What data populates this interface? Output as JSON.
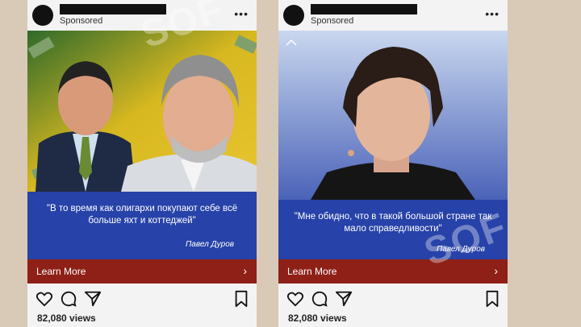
{
  "posts": [
    {
      "sponsored_label": "Sponsored",
      "quote": "\"В то время как олигархи покупают себе всё больше яхт и коттеджей\"",
      "author": "Павел Дуров",
      "cta_label": "Learn More",
      "views": "82,080 views"
    },
    {
      "sponsored_label": "Sponsored",
      "quote": "\"Мне обидно, что в такой большой стране так мало справедливости\"",
      "author": "Павел Дуров",
      "cta_label": "Learn More",
      "views": "82,080 views"
    }
  ],
  "colors": {
    "panel_blue": "#2742a8",
    "cta_red": "#8e2018",
    "background": "#d9c9b7"
  },
  "icons": [
    "more-options-icon",
    "heart-icon",
    "comment-icon",
    "share-icon",
    "bookmark-icon",
    "chevron-right-icon"
  ]
}
